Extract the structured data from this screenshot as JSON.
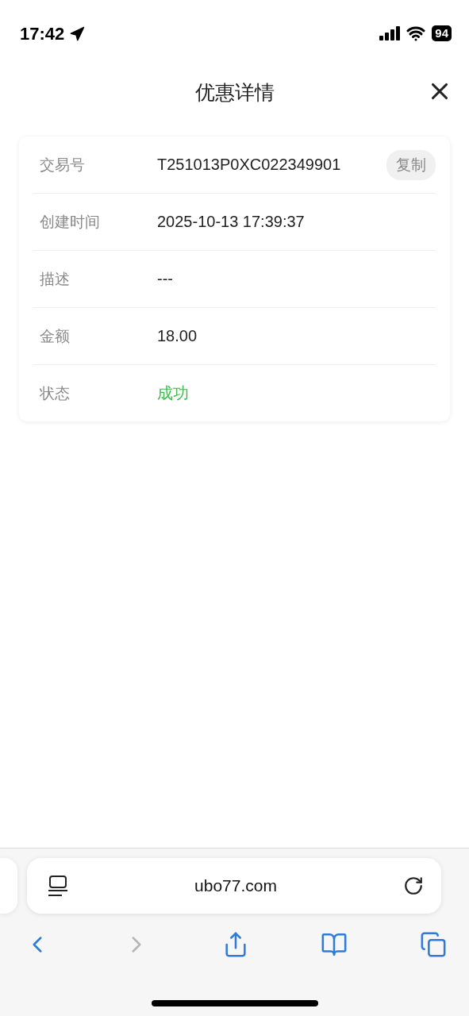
{
  "status_bar": {
    "time": "17:42",
    "battery": "94"
  },
  "header": {
    "title": "优惠详情"
  },
  "details": [
    {
      "label": "交易号",
      "value": "T251013P0XC022349901",
      "kind": "text",
      "action": "复制"
    },
    {
      "label": "创建时间",
      "value": "2025-10-13 17:39:37",
      "kind": "text"
    },
    {
      "label": "描述",
      "value": "---",
      "kind": "text"
    },
    {
      "label": "金额",
      "value": "18.00",
      "kind": "text"
    },
    {
      "label": "状态",
      "value": "成功",
      "kind": "status"
    }
  ],
  "browser": {
    "url": "ubo77.com",
    "toolbar": [
      {
        "kind": "back",
        "disabled": false
      },
      {
        "kind": "forward",
        "disabled": true
      },
      {
        "kind": "share",
        "disabled": false
      },
      {
        "kind": "bookmarks",
        "disabled": false
      },
      {
        "kind": "tabs",
        "disabled": false
      }
    ]
  }
}
